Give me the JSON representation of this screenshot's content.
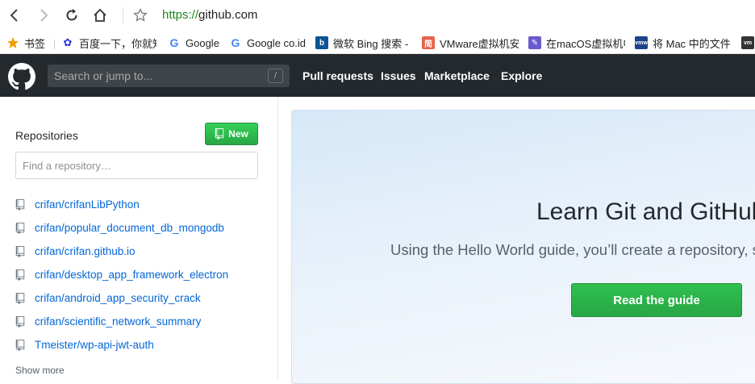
{
  "browser": {
    "url_scheme": "https://",
    "url_host": "github.com",
    "bookmarks": [
      {
        "label": "书签",
        "icon": "star-icon",
        "color": "#f0a000"
      },
      {
        "label": "百度一下，你就知",
        "icon": "baidu-paw-icon",
        "color": "#2932e1"
      },
      {
        "label": "Google",
        "icon": "google-g-icon",
        "color": "#4285f4"
      },
      {
        "label": "Google co.id",
        "icon": "google-g-icon",
        "color": "#4285f4"
      },
      {
        "label": "微软 Bing 搜索 -",
        "icon": "bing-icon",
        "color": "#008373"
      },
      {
        "label": "VMware虚拟机安",
        "icon": "jianshu-icon",
        "color": "#e5624b"
      },
      {
        "label": "在macOS虚拟机中",
        "icon": "pen-icon",
        "color": "#6a5acd"
      },
      {
        "label": "将 Mac 中的文件",
        "icon": "vmware-icon",
        "color": "#1d428a"
      },
      {
        "label": "",
        "icon": "vmware-icon",
        "color": "#333333"
      }
    ]
  },
  "github": {
    "search_placeholder": "Search or jump to...",
    "search_shortcut": "/",
    "nav": [
      "Pull requests",
      "Issues",
      "Marketplace",
      "Explore"
    ],
    "accent_green": "#28a745",
    "link_blue": "#0366d6"
  },
  "sidebar": {
    "heading": "Repositories",
    "new_button": "New",
    "find_placeholder": "Find a repository…",
    "repos": [
      "crifan/crifanLibPython",
      "crifan/popular_document_db_mongodb",
      "crifan/crifan.github.io",
      "crifan/desktop_app_framework_electron",
      "crifan/android_app_security_crack",
      "crifan/scientific_network_summary",
      "Tmeister/wp-api-jwt-auth"
    ],
    "show_more": "Show more"
  },
  "main": {
    "title": "Learn Git and GitHub",
    "subtitle": "Using the Hello World guide, you’ll create a repository, st",
    "guide_button": "Read the guide"
  }
}
